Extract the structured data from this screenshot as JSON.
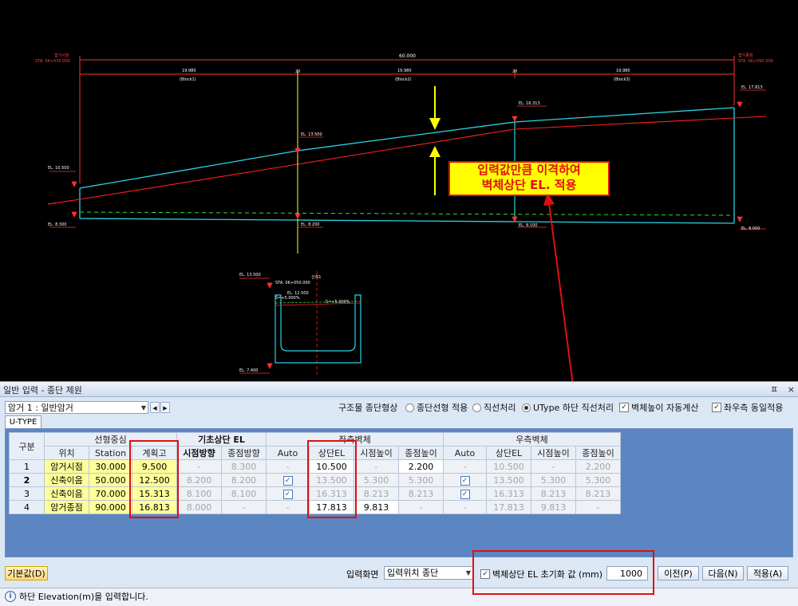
{
  "drawing": {
    "top_labels": {
      "start_station": "STA. 0K+030.000",
      "start_name": "접거시점",
      "end_station": "STA. 0K+090.000",
      "end_name": "접거종점",
      "total_length": "60.000",
      "block1_len": "19.980",
      "block1_name": "(Block1)",
      "block2_len": "19.980",
      "block2_name": "(Block2)",
      "block3_len": "19.980",
      "block3_name": "(Block3)",
      "gap1": "20",
      "gap2": "20"
    },
    "elev": {
      "el_top_left": "EL. 10.500",
      "el_bot_left": "EL. 8.300",
      "el_mid": "EL. 13.500",
      "el_mid_bot": "EL. 8.200",
      "el_right_mid": "EL. 16.313",
      "el_right_mid_bot": "EL. 8.100",
      "el_top_right": "EL. 17.813",
      "el_bot_right": "EL. 8.000"
    },
    "section": {
      "el_top": "EL. 13.500",
      "station": "STA. 0K+050.000",
      "name": "신축1",
      "el_mid": "EL. 12.500",
      "slope_left": "S=+5.000%",
      "slope_right": "S=+5.000%",
      "el_bot": "EL. 7.400"
    },
    "callout": {
      "line1": "입력값만큼 이격하여",
      "line2": "벽체상단 EL. 적용"
    }
  },
  "panel": {
    "title": "일반 입력 - 종단 제원",
    "title_btns": [
      "ㅍ",
      "×"
    ],
    "culvert_select": "암거 1 : 일반암거",
    "struct_label": "구조물 종단형상",
    "opts": {
      "o1": "종단선형 적용",
      "o2": "직선처리",
      "o3": "UType 하단 직선처리",
      "c1": "벽체높이 자동계산",
      "c2": "좌우측 동일적용"
    },
    "tab": "U-TYPE",
    "grid": {
      "h_gubun": "구분",
      "h_center": "선형중심",
      "h_base": "기초상단 EL",
      "h_left": "좌측벽체",
      "h_right": "우측벽체",
      "sub": [
        "위치",
        "Station",
        "계획고",
        "시점방향",
        "종점방향",
        "Auto",
        "상단EL",
        "시점높이",
        "종점높이",
        "Auto",
        "상단EL",
        "시점높이",
        "종점높이"
      ],
      "rows": [
        {
          "no": "1",
          "pos": "암거시점",
          "sta": "30.000",
          "plan": "9.500",
          "bs": "-",
          "be": "8.300",
          "la": "-",
          "lel": "10.500",
          "lsh": "-",
          "leh": "2.200",
          "ra": "-",
          "rel": "10.500",
          "rsh": "-",
          "reh": "2.200"
        },
        {
          "no": "2",
          "pos": "신축이음",
          "sta": "50.000",
          "plan": "12.500",
          "bs": "8.200",
          "be": "8.200",
          "la": "✓",
          "lel": "13.500",
          "lsh": "5.300",
          "leh": "5.300",
          "ra": "✓",
          "rel": "13.500",
          "rsh": "5.300",
          "reh": "5.300"
        },
        {
          "no": "3",
          "pos": "신축이음",
          "sta": "70.000",
          "plan": "15.313",
          "bs": "8.100",
          "be": "8.100",
          "la": "✓",
          "lel": "16.313",
          "lsh": "8.213",
          "leh": "8.213",
          "ra": "✓",
          "rel": "16.313",
          "rsh": "8.213",
          "reh": "8.213"
        },
        {
          "no": "4",
          "pos": "암거종점",
          "sta": "90.000",
          "plan": "16.813",
          "bs": "8.000",
          "be": "-",
          "la": "-",
          "lel": "17.813",
          "lsh": "9.813",
          "leh": "-",
          "ra": "-",
          "rel": "17.813",
          "rsh": "9.813",
          "reh": "-"
        }
      ]
    },
    "bottom": {
      "default_btn": "기본값(D)",
      "input_label": "입력화면",
      "input_select": "입력위치 종단",
      "init_chk": "벽체상단 EL 초기화 값 (mm)",
      "init_value": "1000",
      "prev_btn": "이전(P)",
      "next_btn": "다음(N)",
      "apply_btn": "적용(A)"
    },
    "status": "하단 Elevation(m)을 입력합니다."
  }
}
